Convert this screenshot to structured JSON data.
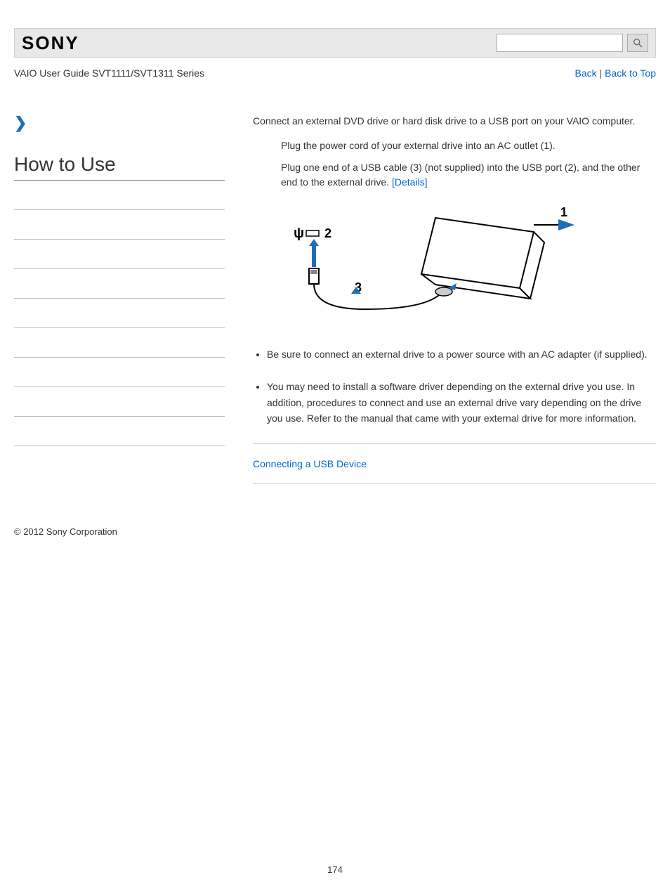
{
  "header": {
    "brand": "SONY",
    "search_placeholder": ""
  },
  "subheader": {
    "guide_title": "VAIO User Guide SVT1111/SVT1311 Series",
    "back_label": "Back",
    "separator": " | ",
    "back_to_top_label": "Back to Top"
  },
  "sidebar": {
    "title": "How to Use",
    "item_count": 9
  },
  "main": {
    "intro": "Connect an external DVD drive or hard disk drive to a USB port on your VAIO computer.",
    "step1": "Plug the power cord of your external drive into an AC outlet (1).",
    "step2a": "Plug one end of a USB cable (3) (not supplied) into the USB port (2), and the other end to the external drive. ",
    "details_link": "[Details]",
    "diagram_labels": {
      "n1": "1",
      "n2": "2",
      "n3": "3"
    },
    "bullets": [
      "Be sure to connect an external drive to a power source with an AC adapter (if supplied).",
      "You may need to install a software driver depending on the external drive you use. In addition, procedures to connect and use an external drive vary depending on the drive you use. Refer to the manual that came with your external drive for more information."
    ],
    "related_link": "Connecting a USB Device"
  },
  "footer": {
    "copyright": "© 2012 Sony Corporation"
  },
  "page_number": "174"
}
